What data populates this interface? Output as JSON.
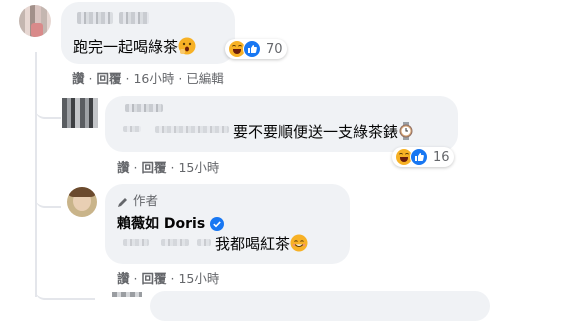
{
  "comments": [
    {
      "text": "跑完一起喝綠茶",
      "emoji": "hushed-hand-emoji",
      "reaction_count": "70",
      "actions": {
        "like": "讚",
        "reply": "回覆",
        "time": "16小時",
        "edited": "已編輯"
      }
    },
    {
      "text": "要不要順便送一支綠茶錶",
      "emoji": "watch-emoji",
      "reaction_count": "16",
      "actions": {
        "like": "讚",
        "reply": "回覆",
        "time": "15小時"
      }
    },
    {
      "author_badge": "作者",
      "author_name": "賴薇如 Doris",
      "text": "我都喝紅茶",
      "emoji": "smiling-emoji",
      "actions": {
        "like": "讚",
        "reply": "回覆",
        "time": "15小時"
      }
    }
  ],
  "separator": "·",
  "colors": {
    "bubble": "#f0f2f5",
    "meta": "#65676b",
    "like_blue": "#1877f2",
    "haha_yellow": "#f7b125",
    "verified_blue": "#1877f2"
  }
}
